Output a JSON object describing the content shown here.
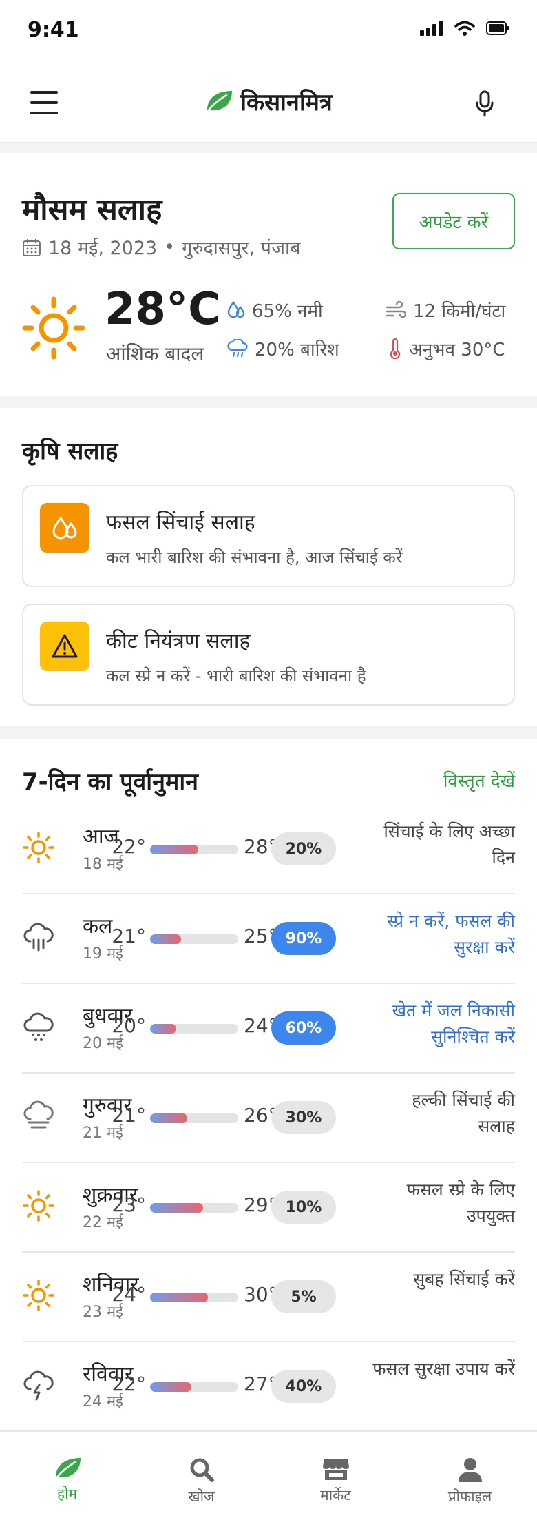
{
  "status_bar": {
    "time": "9:41"
  },
  "header": {
    "brand": "किसानमित्र",
    "brand_icon": "leaf-icon",
    "menu_icon": "hamburger-icon",
    "mic_icon": "microphone-icon"
  },
  "weather": {
    "title": "मौसम सलाह",
    "date": "18 मई, 2023",
    "separator": "•",
    "location": "गुरुदासपुर, पंजाब",
    "update_label": "अपडेट करें",
    "temperature": "28°C",
    "condition": "आंशिक बादल",
    "humidity": "65% नमी",
    "rain": "20% बारिश",
    "wind": "12 किमी/घंटा",
    "feels_like": "अनुभव 30°C"
  },
  "advice": {
    "title": "कृषि सलाह",
    "items": [
      {
        "title": "फसल सिंचाई सलाह",
        "desc": "कल भारी बारिश की संभावना है, आज सिंचाई करें",
        "icon": "water-drops-icon",
        "color": "#f59300"
      },
      {
        "title": "कीट नियंत्रण सलाह",
        "desc": "कल स्प्रे न करें - भारी बारिश की संभावना है",
        "icon": "warning-icon",
        "color": "#ffc107"
      }
    ]
  },
  "forecast": {
    "title": "7-दिन का पूर्वानुमान",
    "view_all": "विस्तृत देखें",
    "days": [
      {
        "name": "आज",
        "date": "18 मई",
        "min": "22°",
        "max": "28°",
        "rain": "20%",
        "advice": "सिंचाई के लिए अच्छा दिन",
        "icon": "sun-icon",
        "alert": false,
        "bar_start": 0.0,
        "bar_end": 0.55
      },
      {
        "name": "कल",
        "date": "19 मई",
        "min": "21°",
        "max": "25°",
        "rain": "90%",
        "advice": "स्प्रे न करें, फसल की सुरक्षा करें",
        "icon": "rain-cloud-icon",
        "alert": true,
        "bar_start": 0.0,
        "bar_end": 0.35
      },
      {
        "name": "बुधवार",
        "date": "20 मई",
        "min": "20°",
        "max": "24°",
        "rain": "60%",
        "advice": "खेत में जल निकासी सुनिश्चित करें",
        "icon": "drizzle-cloud-icon",
        "alert": true,
        "bar_start": 0.0,
        "bar_end": 0.3
      },
      {
        "name": "गुरुवार",
        "date": "21 मई",
        "min": "21°",
        "max": "26°",
        "rain": "30%",
        "advice": "हल्की सिंचाई की सलाह",
        "icon": "fog-cloud-icon",
        "alert": false,
        "bar_start": 0.0,
        "bar_end": 0.42
      },
      {
        "name": "शुक्रवार",
        "date": "22 मई",
        "min": "23°",
        "max": "29°",
        "rain": "10%",
        "advice": "फसल स्प्रे के लिए उपयुक्त",
        "icon": "sun-icon",
        "alert": false,
        "bar_start": 0.0,
        "bar_end": 0.6
      },
      {
        "name": "शनिवार",
        "date": "23 मई",
        "min": "24°",
        "max": "30°",
        "rain": "5%",
        "advice": "सुबह सिंचाई करें",
        "icon": "sun-icon",
        "alert": false,
        "bar_start": 0.0,
        "bar_end": 0.66
      },
      {
        "name": "रविवार",
        "date": "24 मई",
        "min": "22°",
        "max": "27°",
        "rain": "40%",
        "advice": "फसल सुरक्षा उपाय करें",
        "icon": "thunder-cloud-icon",
        "alert": false,
        "bar_start": 0.0,
        "bar_end": 0.47
      }
    ]
  },
  "nav": {
    "items": [
      {
        "label": "होम",
        "icon": "leaf-icon",
        "active": true
      },
      {
        "label": "खोज",
        "icon": "search-icon",
        "active": false
      },
      {
        "label": "मार्केट",
        "icon": "store-icon",
        "active": false
      },
      {
        "label": "प्रोफाइल",
        "icon": "user-icon",
        "active": false
      }
    ]
  },
  "colors": {
    "brand_green": "#2f9e3f",
    "accent_blue": "#3d86ee",
    "sun_orange": "#f59300"
  }
}
